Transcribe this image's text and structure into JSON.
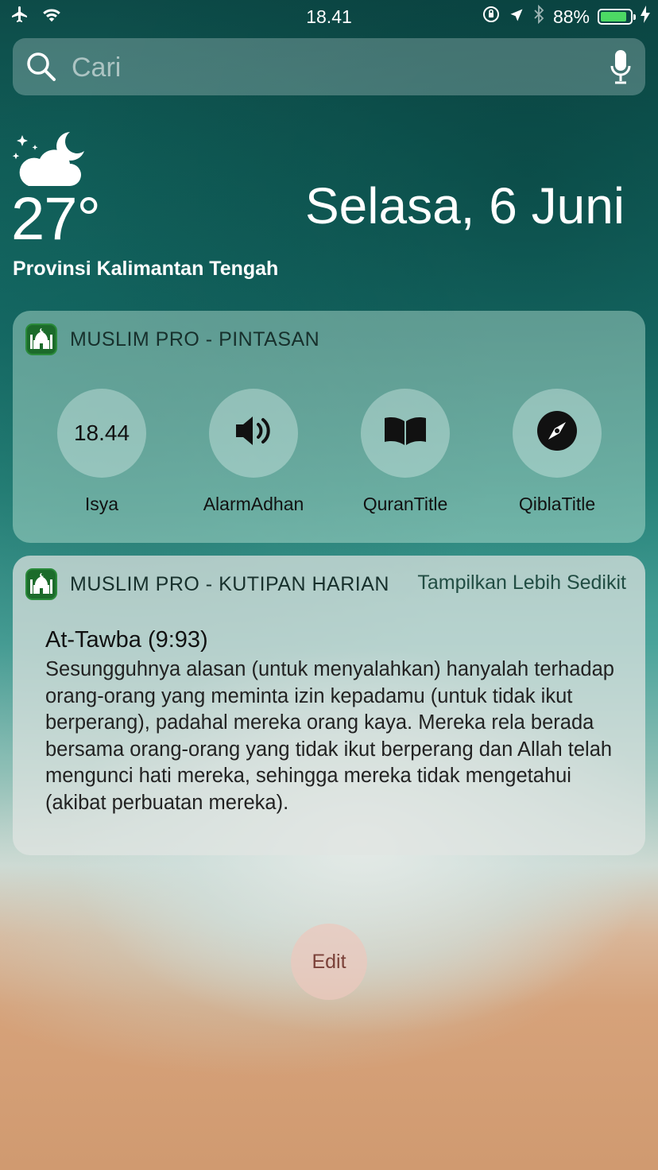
{
  "status_bar": {
    "time": "18.41",
    "battery_percent": "88%",
    "battery_level": 0.88,
    "battery_color": "#4cd964",
    "icons": [
      "airplane-icon",
      "wifi-icon",
      "orientation-lock-icon",
      "location-icon",
      "bluetooth-icon",
      "battery-icon",
      "charging-icon"
    ]
  },
  "search": {
    "placeholder": "Cari",
    "icons": [
      "search-icon",
      "microphone-icon"
    ]
  },
  "weather": {
    "icon": "partly-cloudy-night-icon",
    "temperature": "27°",
    "location": "Provinsi Kalimantan Tengah"
  },
  "date": "Selasa, 6 Juni",
  "widget_shortcuts": {
    "app_icon": "muslim-pro-mosque-icon",
    "title": "MUSLIM PRO - PINTASAN",
    "items": [
      {
        "value": "18.44",
        "label": "Isya"
      },
      {
        "icon": "speaker-icon",
        "label": "AlarmAdhan"
      },
      {
        "icon": "book-icon",
        "label": "QuranTitle"
      },
      {
        "icon": "compass-icon",
        "label": "QiblaTitle"
      }
    ]
  },
  "widget_quote": {
    "app_icon": "muslim-pro-mosque-icon",
    "title": "MUSLIM PRO - KUTIPAN HARIAN",
    "toggle_label": "Tampilkan Lebih Sedikit",
    "verse_ref": "At-Tawba (9:93)",
    "verse_text": "Sesungguhnya alasan (untuk menyalahkan) hanyalah terhadap orang-orang yang meminta izin kepadamu (untuk tidak ikut berperang), padahal mereka orang kaya. Mereka rela berada bersama orang-orang yang tidak ikut berperang dan Allah telah mengunci hati mereka, sehingga mereka tidak mengetahui (akibat perbuatan mereka)."
  },
  "edit_label": "Edit"
}
